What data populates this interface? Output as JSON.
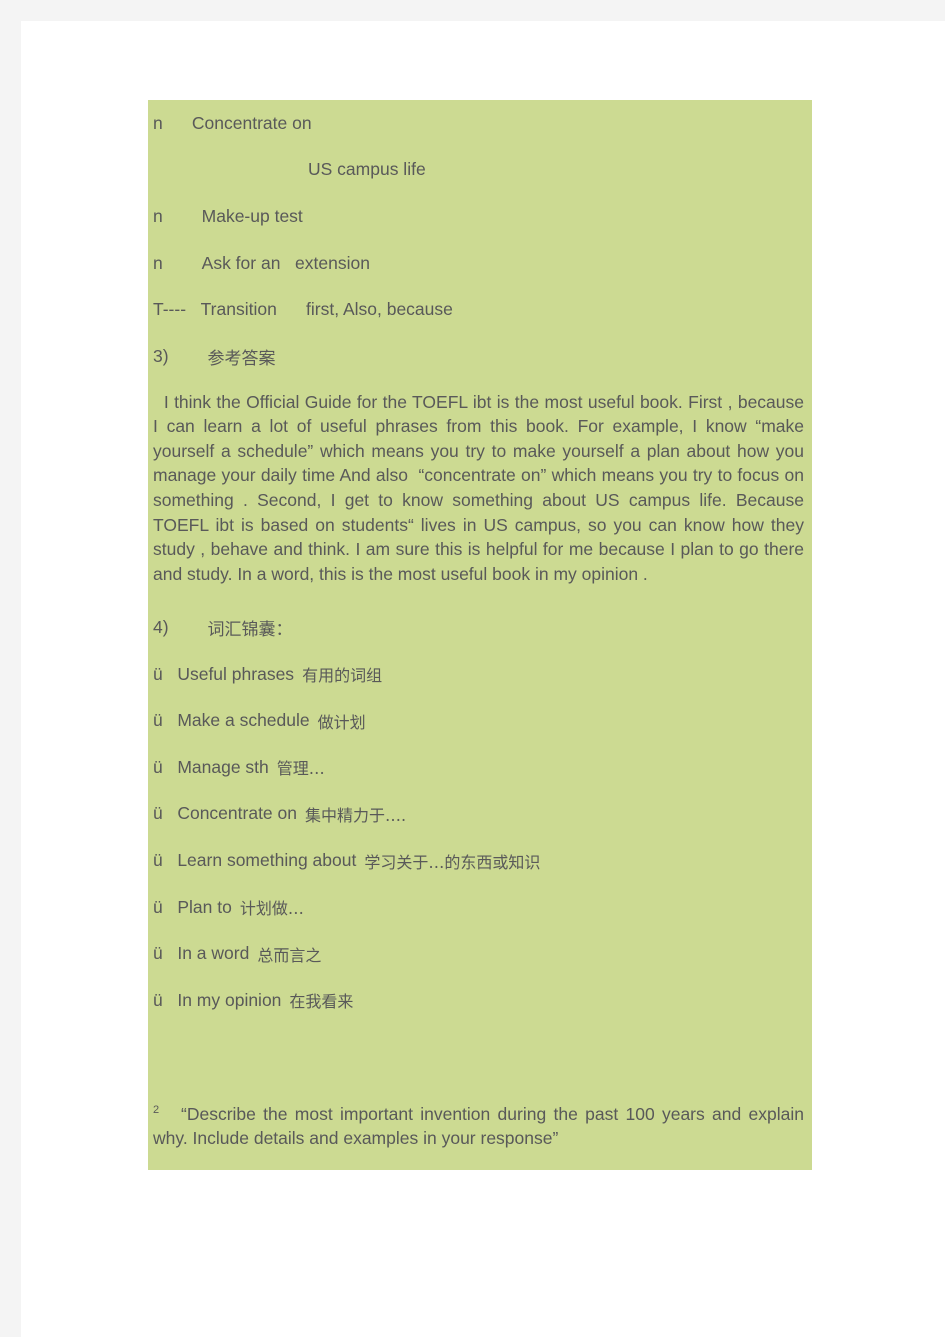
{
  "document": {
    "outline_lines": [
      {
        "bullet": "n",
        "gap": "      ",
        "text": "Concentrate on"
      },
      {
        "bullet": "",
        "gap": "",
        "text": "US campus life"
      },
      {
        "bullet": "n",
        "gap": "        ",
        "text": "Make-up test"
      },
      {
        "bullet": "n",
        "gap": "        ",
        "text": "Ask for an   extension"
      },
      {
        "bullet": "T----",
        "gap": "   ",
        "text": "Transition      first, Also, because"
      }
    ],
    "section_answer": {
      "number": "3)",
      "number_gap": "        ",
      "title": "参考答案",
      "text": "  I think the Official Guide for the TOEFL ibt is the most useful book. First , because   I can learn a lot of useful phrases from this book. For example, I know “make yourself a schedule” which means you try to make yourself a plan about how you manage your daily time And also  “concentrate on” which means you try to focus on something . Second, I get to know something about US campus life. Because TOEFL ibt is based on students“ lives in US campus, so you can know how they study , behave and think. I am sure this is helpful for me because I plan to go there and study. In a word, this is the most useful book in my opinion ."
    },
    "section_vocab": {
      "number": "4)",
      "number_gap": "        ",
      "title": "词汇锦囊：",
      "items": [
        {
          "mark": "ü",
          "gap": "   ",
          "term": "Useful phrases",
          "gloss": "有用的词组"
        },
        {
          "mark": "ü",
          "gap": "   ",
          "term": "Make a schedule",
          "gloss": "做计划"
        },
        {
          "mark": "ü",
          "gap": "   ",
          "term": "Manage sth",
          "gloss": "管理…"
        },
        {
          "mark": "ü",
          "gap": "   ",
          "term": "Concentrate on",
          "gloss": "集中精力于…."
        },
        {
          "mark": "ü",
          "gap": "   ",
          "term": "Learn something about",
          "gloss": "学习关于…的东西或知识"
        },
        {
          "mark": "ü",
          "gap": "   ",
          "term": "Plan to",
          "gloss": "计划做…"
        },
        {
          "mark": "ü",
          "gap": "   ",
          "term": "In a word",
          "gloss": "总而言之"
        },
        {
          "mark": "ü",
          "gap": "   ",
          "term": "In my opinion",
          "gloss": "在我看来"
        }
      ]
    },
    "section_prompt": {
      "marker": "2",
      "text": "   “Describe the most important invention during the past 100 years and explain why. Include details and examples in your response”"
    }
  },
  "colors": {
    "canvas": "#f4f4f4",
    "page": "#ffffff",
    "highlight": "#ccda92",
    "text": "#595959"
  }
}
